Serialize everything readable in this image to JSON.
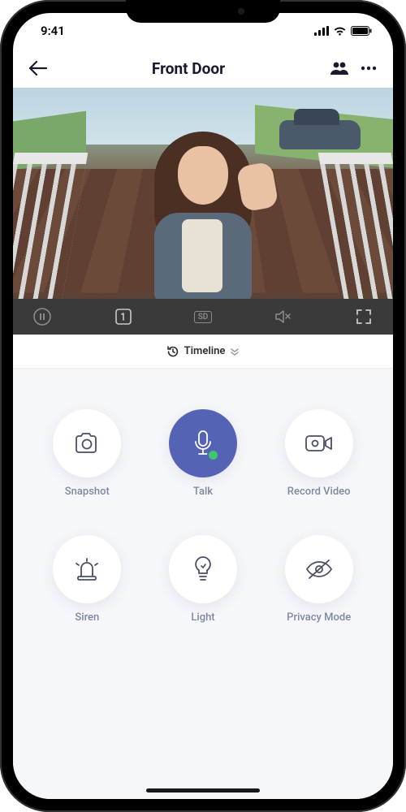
{
  "status": {
    "time": "9:41"
  },
  "nav": {
    "title": "Front Door"
  },
  "video_controls": {
    "quality_label": "SD"
  },
  "timeline": {
    "label": "Timeline"
  },
  "actions": {
    "snapshot": {
      "label": "Snapshot"
    },
    "talk": {
      "label": "Talk"
    },
    "record": {
      "label": "Record Video"
    },
    "siren": {
      "label": "Siren"
    },
    "light": {
      "label": "Light"
    },
    "privacy": {
      "label": "Privacy Mode"
    }
  },
  "colors": {
    "primary": "#5563b5",
    "panel_bg": "#f6f7fa",
    "video_bar": "#3a3a3a"
  }
}
